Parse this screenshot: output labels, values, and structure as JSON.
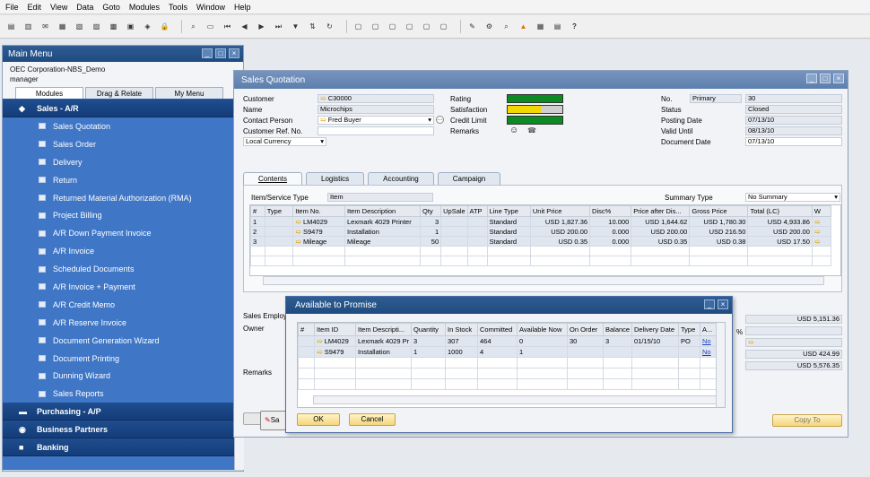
{
  "menubar": [
    "File",
    "Edit",
    "View",
    "Data",
    "Goto",
    "Modules",
    "Tools",
    "Window",
    "Help"
  ],
  "main_menu": {
    "title": "Main Menu",
    "company": "OEC Corporation-NBS_Demo",
    "user": "manager",
    "tabs": [
      "Modules",
      "Drag & Relate",
      "My Menu"
    ],
    "group_sales": "Sales - A/R",
    "items": [
      "Sales Quotation",
      "Sales Order",
      "Delivery",
      "Return",
      "Returned Material Authorization (RMA)",
      "Project Billing",
      "A/R Down Payment Invoice",
      "A/R Invoice",
      "Scheduled Documents",
      "A/R Invoice + Payment",
      "A/R Credit Memo",
      "A/R Reserve Invoice",
      "Document Generation Wizard",
      "Document Printing",
      "Dunning Wizard",
      "Sales Reports"
    ],
    "group_purchasing": "Purchasing - A/P",
    "group_bp": "Business Partners",
    "group_banking": "Banking"
  },
  "sq": {
    "title": "Sales Quotation",
    "labels": {
      "customer": "Customer",
      "name": "Name",
      "contact": "Contact Person",
      "ref": "Customer Ref. No.",
      "currency": "Local Currency",
      "rating": "Rating",
      "satisfaction": "Satisfaction",
      "credit": "Credit Limit",
      "remarks": "Remarks",
      "no": "No.",
      "status": "Status",
      "posting": "Posting Date",
      "valid": "Valid Until",
      "docdate": "Document Date"
    },
    "values": {
      "customer": "C30000",
      "name": "Microchips",
      "contact": "Fred Buyer",
      "no_series": "Primary",
      "no": "30",
      "status": "Closed",
      "posting": "07/13/10",
      "valid": "08/13/10",
      "docdate": "07/13/10"
    },
    "tabs": [
      "Contents",
      "Logistics",
      "Accounting",
      "Campaign"
    ],
    "item_service_type_label": "Item/Service Type",
    "item_service_type": "Item",
    "summary_type_label": "Summary Type",
    "summary_type": "No Summary",
    "columns": [
      "#",
      "Type",
      "Item No.",
      "Item Description",
      "Qty",
      "UpSale",
      "ATP",
      "Line Type",
      "Unit Price",
      "Disc%",
      "Price after Dis...",
      "Gross Price",
      "Total (LC)",
      "W"
    ],
    "rows": [
      [
        "1",
        "",
        "LM4029",
        "Lexmark 4029 Printer",
        "3",
        "",
        "",
        "Standard",
        "USD 1,827.36",
        "10.000",
        "USD 1,644.62",
        "USD 1,780.30",
        "USD 4,933.86"
      ],
      [
        "2",
        "",
        "S9479",
        "Installation",
        "1",
        "",
        "",
        "Standard",
        "USD 200.00",
        "0.000",
        "USD 200.00",
        "USD 216.50",
        "USD 200.00"
      ],
      [
        "3",
        "",
        "Mileage",
        "Mileage",
        "50",
        "",
        "",
        "Standard",
        "USD 0.35",
        "0.000",
        "USD 0.35",
        "USD 0.38",
        "USD 17.50"
      ]
    ],
    "bottom_labels": {
      "employee": "Sales Employee",
      "owner": "Owner",
      "remarks": "Remarks"
    },
    "totals": [
      "USD 5,151.36",
      "",
      "",
      "USD 424.99",
      "USD 5,576.35"
    ],
    "pct": "%",
    "copy_to": "Copy To",
    "add_label": "Sa"
  },
  "atp": {
    "title": "Available to Promise",
    "columns": [
      "#",
      "Item ID",
      "Item Descripti...",
      "Quantity",
      "In Stock",
      "Committed",
      "Available Now",
      "On Order",
      "Balance",
      "Delivery Date",
      "Type",
      "A..."
    ],
    "rows": [
      [
        "",
        "LM4029",
        "Lexmark 4029 Pr",
        "3",
        "307",
        "464",
        "0",
        "30",
        "3",
        "01/15/10",
        "PO",
        "No"
      ],
      [
        "",
        "S9479",
        "Installation",
        "1",
        "1000",
        "4",
        "1",
        "",
        "",
        "",
        "",
        "No"
      ]
    ],
    "ok": "OK",
    "cancel": "Cancel"
  }
}
